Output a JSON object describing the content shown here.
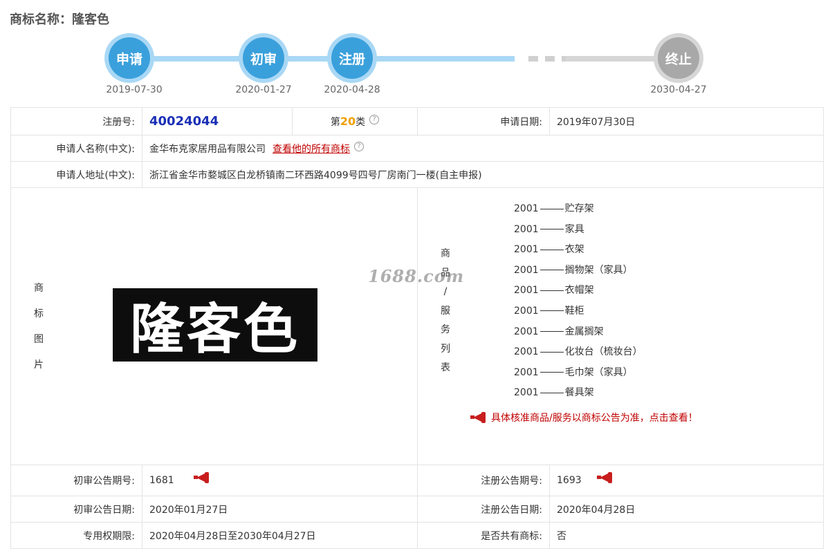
{
  "title": "商标名称：隆客色",
  "timeline": [
    {
      "label": "申请",
      "date": "2019-07-30",
      "state": "done"
    },
    {
      "label": "初审",
      "date": "2020-01-27",
      "state": "done"
    },
    {
      "label": "注册",
      "date": "2020-04-28",
      "state": "done"
    },
    {
      "label": "终止",
      "date": "2030-04-27",
      "state": "future"
    }
  ],
  "colors": {
    "accent": "#3aa0dc",
    "accent_light": "#a9d8f5",
    "link_red": "#c00000",
    "reg_blue": "#1a2fb5",
    "class_orange": "#f0a000"
  },
  "info": {
    "reg_no_label": "注册号:",
    "reg_no": "40024044",
    "class_prefix": "第",
    "class_num": "20",
    "class_suffix": "类",
    "help_glyph": "?",
    "apply_date_label": "申请日期:",
    "apply_date": "2019年07月30日",
    "applicant_label": "申请人名称(中文):",
    "applicant": "金华布克家居用品有限公司",
    "applicant_link": "查看他的所有商标",
    "address_label": "申请人地址(中文):",
    "address": "浙江省金华市婺城区白龙桥镇南二环西路4099号四号厂房南门一楼(自主申报)",
    "image_label_chars": [
      "商",
      "标",
      "图",
      "片"
    ],
    "logo_text": "隆客色",
    "goods_label_chars": [
      "商",
      "品",
      "/",
      "服",
      "务",
      "列",
      "表"
    ],
    "goods": [
      {
        "code": "2001",
        "name": "贮存架"
      },
      {
        "code": "2001",
        "name": "家具"
      },
      {
        "code": "2001",
        "name": "衣架"
      },
      {
        "code": "2001",
        "name": "搁物架（家具）"
      },
      {
        "code": "2001",
        "name": "衣帽架"
      },
      {
        "code": "2001",
        "name": "鞋柜"
      },
      {
        "code": "2001",
        "name": "金属搁架"
      },
      {
        "code": "2001",
        "name": "化妆台（梳妆台）"
      },
      {
        "code": "2001",
        "name": "毛巾架（家具）"
      },
      {
        "code": "2001",
        "name": "餐具架"
      }
    ],
    "goods_notice": "具体核准商品/服务以商标公告为准，点击查看！",
    "prelim_no_label": "初审公告期号:",
    "prelim_no": "1681",
    "reg_pub_no_label": "注册公告期号:",
    "reg_pub_no": "1693",
    "prelim_date_label": "初审公告日期:",
    "prelim_date": "2020年01月27日",
    "reg_pub_date_label": "注册公告日期:",
    "reg_pub_date": "2020年04月28日",
    "exclusive_label": "专用权期限:",
    "exclusive": "2020年04月28日至2030年04月27日",
    "shared_label": "是否共有商标:",
    "shared": "否"
  },
  "watermark": "1688.com",
  "icons": {
    "help": "question-circle-icon",
    "notice": "megaphone-icon"
  }
}
